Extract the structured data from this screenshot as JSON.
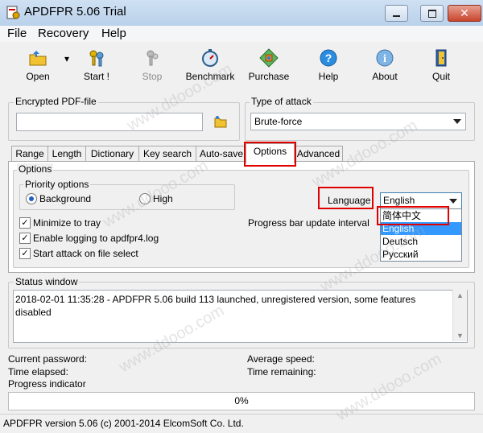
{
  "window": {
    "title": "APDFPR 5.06 Trial"
  },
  "menu": [
    "File",
    "Recovery",
    "Help"
  ],
  "toolbar": {
    "open": "Open",
    "start": "Start !",
    "stop": "Stop",
    "benchmark": "Benchmark",
    "purchase": "Purchase",
    "help": "Help",
    "about": "About",
    "quit": "Quit"
  },
  "encrypted_file": {
    "label": "Encrypted PDF-file",
    "value": ""
  },
  "attack": {
    "label": "Type of attack",
    "value": "Brute-force"
  },
  "tabs": [
    "Range",
    "Length",
    "Dictionary",
    "Key search",
    "Auto-save",
    "Options",
    "Advanced"
  ],
  "options": {
    "group_label": "Options",
    "priority": {
      "label": "Priority options",
      "background": "Background",
      "high": "High"
    },
    "minimize": "Minimize to tray",
    "logging": "Enable logging to apdfpr4.log",
    "start_on_select": "Start attack on file select",
    "progress_interval": "Progress bar update interval",
    "language": {
      "label": "Language",
      "value": "English",
      "options": [
        "简体中文",
        "English",
        "Deutsch",
        "Русский"
      ]
    }
  },
  "status": {
    "label": "Status window",
    "message": "2018-02-01 11:35:28 - APDFPR 5.06 build 113 launched, unregistered version, some features disabled"
  },
  "info": {
    "current_password": "Current password:",
    "time_elapsed": "Time elapsed:",
    "progress_indicator": "Progress indicator",
    "average_speed": "Average speed:",
    "time_remaining": "Time remaining:"
  },
  "progress": {
    "value": 0,
    "text": "0%"
  },
  "statusbar": "APDFPR version 5.06 (c) 2001-2014 ElcomSoft Co. Ltd.",
  "watermark": "www.ddooo.com"
}
